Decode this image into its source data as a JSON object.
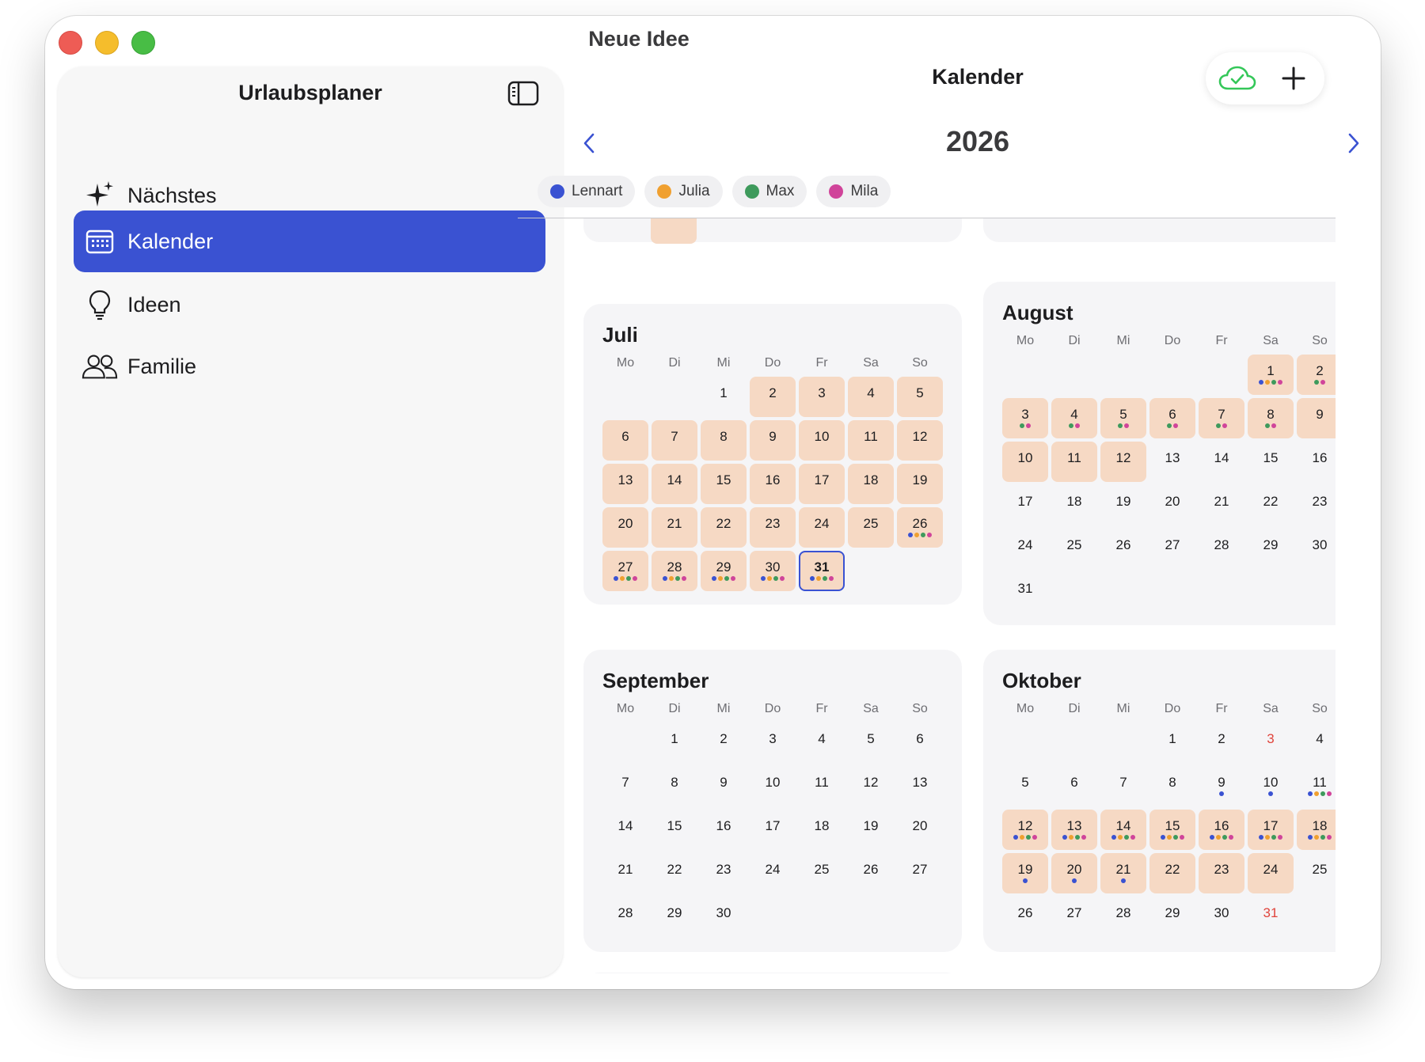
{
  "window": {
    "title": "Neue Idee"
  },
  "sidebar": {
    "title": "Urlaubsplaner",
    "items": [
      {
        "label": "Nächstes",
        "icon": "sparkles-icon",
        "active": false
      },
      {
        "label": "Kalender",
        "icon": "calendar-icon",
        "active": true
      },
      {
        "label": "Ideen",
        "icon": "lightbulb-icon",
        "active": false
      },
      {
        "label": "Familie",
        "icon": "people-icon",
        "active": false
      }
    ]
  },
  "main": {
    "title": "Kalender",
    "year": "2026",
    "members": [
      {
        "name": "Lennart",
        "color": "#3a52d2"
      },
      {
        "name": "Julia",
        "color": "#f0a030"
      },
      {
        "name": "Max",
        "color": "#3e9a5c"
      },
      {
        "name": "Mila",
        "color": "#d0449a"
      }
    ],
    "weekdays": [
      "Mo",
      "Di",
      "Mi",
      "Do",
      "Fr",
      "Sa",
      "So"
    ]
  },
  "colors": {
    "accent": "#3a52d2",
    "vacation": "#f6d9c4",
    "holiday_text": "#e0443c",
    "sync_ok": "#34c759"
  },
  "months": [
    {
      "name": "Juli",
      "days": 31,
      "offset": 2,
      "vacation": [
        2,
        3,
        4,
        5,
        6,
        7,
        8,
        9,
        10,
        11,
        12,
        13,
        14,
        15,
        16,
        17,
        18,
        19,
        20,
        21,
        22,
        23,
        24,
        25,
        26,
        27,
        28,
        29,
        30,
        31
      ],
      "today": 31,
      "dots": {
        "26": [
          0,
          1,
          2,
          3
        ],
        "27": [
          0,
          1,
          2,
          3
        ],
        "28": [
          0,
          1,
          2,
          3
        ],
        "29": [
          0,
          1,
          2,
          3
        ],
        "30": [
          0,
          1,
          2,
          3
        ],
        "31": [
          0,
          1,
          2,
          3
        ]
      }
    },
    {
      "name": "August",
      "days": 31,
      "offset": 5,
      "vacation": [
        1,
        2,
        3,
        4,
        5,
        6,
        7,
        8,
        9,
        10,
        11,
        12
      ],
      "dots": {
        "1": [
          0,
          1,
          2,
          3
        ],
        "2": [
          2,
          3
        ],
        "3": [
          2,
          3
        ],
        "4": [
          2,
          3
        ],
        "5": [
          2,
          3
        ],
        "6": [
          2,
          3
        ],
        "7": [
          2,
          3
        ],
        "8": [
          2,
          3
        ]
      }
    },
    {
      "name": "September",
      "days": 30,
      "offset": 1,
      "vacation": [],
      "dots": {}
    },
    {
      "name": "Oktober",
      "days": 31,
      "offset": 3,
      "vacation": [
        12,
        13,
        14,
        15,
        16,
        17,
        18,
        19,
        20,
        21,
        22,
        23,
        24
      ],
      "red": [
        3,
        31
      ],
      "dots": {
        "9": [
          0
        ],
        "10": [
          0
        ],
        "11": [
          0,
          1,
          2,
          3
        ],
        "12": [
          0,
          1,
          2,
          3
        ],
        "13": [
          0,
          1,
          2,
          3
        ],
        "14": [
          0,
          1,
          2,
          3
        ],
        "15": [
          0,
          1,
          2,
          3
        ],
        "16": [
          0,
          1,
          2,
          3
        ],
        "17": [
          0,
          1,
          2,
          3
        ],
        "18": [
          0,
          1,
          2,
          3
        ],
        "19": [
          0
        ],
        "20": [
          0
        ],
        "21": [
          0
        ]
      }
    }
  ]
}
